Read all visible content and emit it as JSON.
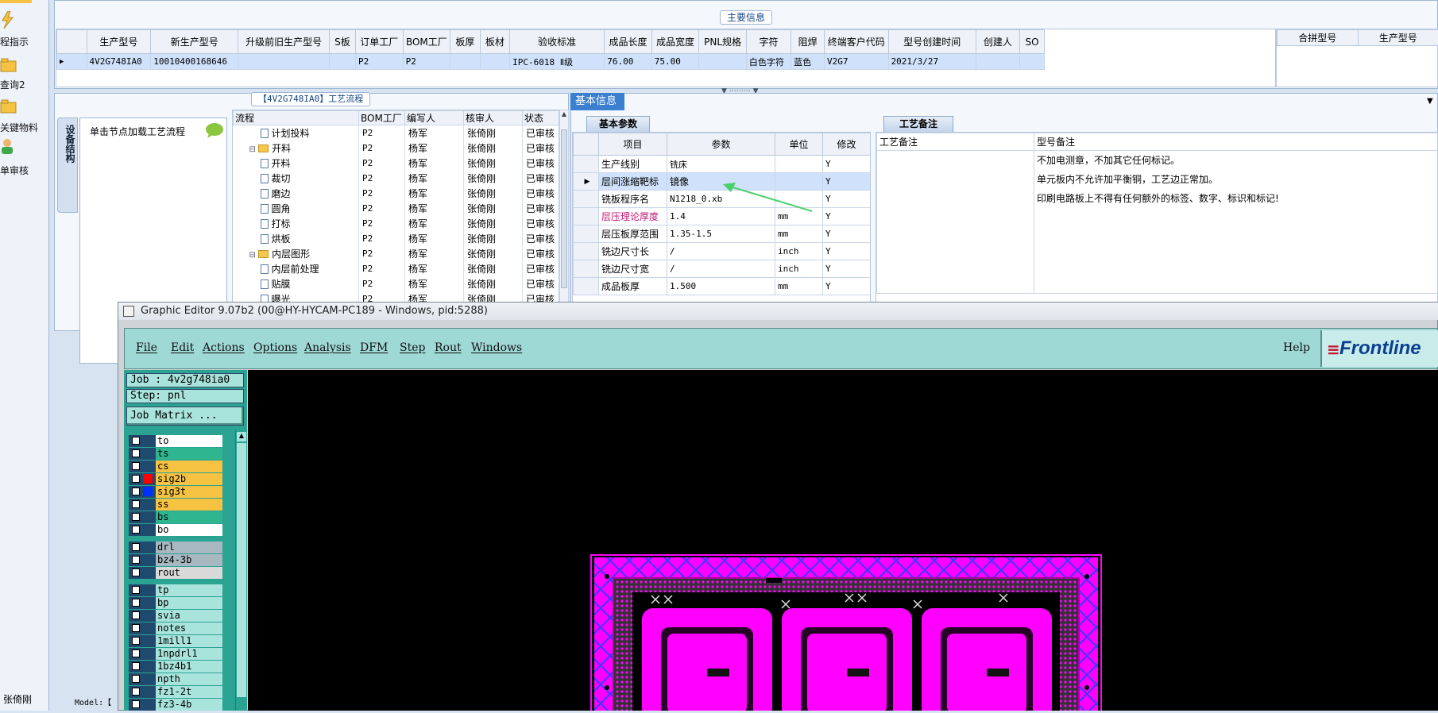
{
  "sidebar": {
    "items": [
      {
        "label": "程指示"
      },
      {
        "label": "查询2"
      },
      {
        "label": "关键物料"
      },
      {
        "label": "单审核"
      }
    ],
    "user": "张倚刚"
  },
  "status": {
    "model": "Model:【"
  },
  "main_info": {
    "title": "主要信息",
    "columns": [
      "生产型号",
      "新生产型号",
      "升级前旧生产型号",
      "S板",
      "订单工厂",
      "BOM工厂",
      "板厚",
      "板材",
      "验收标准",
      "成品长度",
      "成品宽度",
      "PNL规格",
      "字符",
      "阻焊",
      "终端客户代码",
      "型号创建时间",
      "创建人",
      "SO"
    ],
    "row": [
      "4V2G748IA0",
      "10010400168646",
      "",
      "",
      "P2",
      "P2",
      "",
      "",
      "IPC-6018 Ⅱ级",
      "76.00",
      "75.00",
      "",
      "白色字符",
      "蓝色",
      "V2G7",
      "2021/3/27",
      "",
      ""
    ],
    "right_columns": [
      "合拼型号",
      "生产型号"
    ]
  },
  "flow": {
    "title": "【4V2G748IA0】工艺流程",
    "vtab": "设备结构",
    "hint": "单击节点加载工艺流程",
    "columns": [
      "流程",
      "BOM工厂",
      "编写人",
      "核审人",
      "状态"
    ],
    "rows": [
      {
        "name": "计划投料",
        "type": "doc",
        "indent": 1,
        "bom": "P2",
        "writer": "杨军",
        "reviewer": "张倚刚",
        "status": "已审核"
      },
      {
        "name": "开料",
        "type": "folder",
        "indent": 0,
        "bom": "P2",
        "writer": "杨军",
        "reviewer": "张倚刚",
        "status": "已审核"
      },
      {
        "name": "开料",
        "type": "doc",
        "indent": 1,
        "bom": "P2",
        "writer": "杨军",
        "reviewer": "张倚刚",
        "status": "已审核"
      },
      {
        "name": "裁切",
        "type": "doc",
        "indent": 1,
        "bom": "P2",
        "writer": "杨军",
        "reviewer": "张倚刚",
        "status": "已审核"
      },
      {
        "name": "磨边",
        "type": "doc",
        "indent": 1,
        "bom": "P2",
        "writer": "杨军",
        "reviewer": "张倚刚",
        "status": "已审核"
      },
      {
        "name": "圆角",
        "type": "doc",
        "indent": 1,
        "bom": "P2",
        "writer": "杨军",
        "reviewer": "张倚刚",
        "status": "已审核"
      },
      {
        "name": "打标",
        "type": "doc",
        "indent": 1,
        "bom": "P2",
        "writer": "杨军",
        "reviewer": "张倚刚",
        "status": "已审核"
      },
      {
        "name": "烘板",
        "type": "doc",
        "indent": 1,
        "bom": "P2",
        "writer": "杨军",
        "reviewer": "张倚刚",
        "status": "已审核"
      },
      {
        "name": "内层图形",
        "type": "folder",
        "indent": 0,
        "bom": "P2",
        "writer": "杨军",
        "reviewer": "张倚刚",
        "status": "已审核"
      },
      {
        "name": "内层前处理",
        "type": "doc",
        "indent": 1,
        "bom": "P2",
        "writer": "杨军",
        "reviewer": "张倚刚",
        "status": "已审核"
      },
      {
        "name": "贴膜",
        "type": "doc",
        "indent": 1,
        "bom": "P2",
        "writer": "杨军",
        "reviewer": "张倚刚",
        "status": "已审核"
      },
      {
        "name": "曝光",
        "type": "doc",
        "indent": 1,
        "bom": "P2",
        "writer": "杨军",
        "reviewer": "张倚刚",
        "status": "已审核"
      }
    ]
  },
  "basic": {
    "title": "基本信息",
    "tab_params": "基本参数",
    "tab_remarks": "工艺备注",
    "param_columns": [
      "项目",
      "参数",
      "单位",
      "修改"
    ],
    "params": [
      {
        "item": "生产线别",
        "value": "铣床",
        "unit": "",
        "edit": "Y"
      },
      {
        "item": "层间涨缩靶标",
        "value": "镜像",
        "unit": "",
        "edit": "Y",
        "selected": true
      },
      {
        "item": "铣板程序名",
        "value": "N1218_0.xb",
        "unit": "",
        "edit": "Y"
      },
      {
        "item": "层压理论厚度",
        "value": "1.4",
        "unit": "mm",
        "edit": "Y",
        "highlight": true
      },
      {
        "item": "层压板厚范围",
        "value": "1.35-1.5",
        "unit": "mm",
        "edit": "Y"
      },
      {
        "item": "铣边尺寸长",
        "value": "/",
        "unit": "inch",
        "edit": "Y"
      },
      {
        "item": "铣边尺寸宽",
        "value": "/",
        "unit": "inch",
        "edit": "Y"
      },
      {
        "item": "成品板厚",
        "value": "1.500",
        "unit": "mm",
        "edit": "Y"
      }
    ],
    "remark_columns": [
      "工艺备注",
      "型号备注"
    ],
    "remarks": [
      "不加电测章，不加其它任何标记。",
      "单元板内不允许加平衡铜，工艺边正常加。",
      "印刷电路板上不得有任何额外的标签、数字、标识和标记!"
    ]
  },
  "editor": {
    "title": "Graphic Editor 9.07b2 (00@HY-HYCAM-PC189 - Windows, pid:5288)",
    "menu": [
      "File",
      "Edit",
      "Actions",
      "Options",
      "Analysis",
      "DFM",
      "Step",
      "Rout",
      "Windows"
    ],
    "help": "Help",
    "logo": "Frontline",
    "job": "Job : 4v2g748ia0",
    "step": "Step: pnl",
    "job_matrix": "Job Matrix ...",
    "layers": [
      {
        "name": "to",
        "color": "#ffffff",
        "mark": ""
      },
      {
        "name": "ts",
        "color": "#2fb58f",
        "mark": ""
      },
      {
        "name": "cs",
        "color": "#f5c242",
        "mark": ""
      },
      {
        "name": "sig2b",
        "color": "#f5c242",
        "mark": "#ff0000"
      },
      {
        "name": "sig3t",
        "color": "#f5c242",
        "mark": "#0030ff"
      },
      {
        "name": "ss",
        "color": "#f5c242",
        "mark": ""
      },
      {
        "name": "bs",
        "color": "#2fb58f",
        "mark": ""
      },
      {
        "name": "bo",
        "color": "#ffffff",
        "mark": ""
      },
      {
        "name": "drl",
        "color": "#a7b8c0",
        "mark": ""
      },
      {
        "name": "bz4-3b",
        "color": "#a7b8c0",
        "mark": ""
      },
      {
        "name": "rout",
        "color": "#d9d9d9",
        "mark": ""
      },
      {
        "name": "tp",
        "color": "#a8e3dc",
        "mark": ""
      },
      {
        "name": "bp",
        "color": "#a8e3dc",
        "mark": ""
      },
      {
        "name": "svia",
        "color": "#a8e3dc",
        "mark": ""
      },
      {
        "name": "notes",
        "color": "#a8e3dc",
        "mark": ""
      },
      {
        "name": "1mill1",
        "color": "#a8e3dc",
        "mark": ""
      },
      {
        "name": "1npdrl1",
        "color": "#a8e3dc",
        "mark": ""
      },
      {
        "name": "1bz4b1",
        "color": "#a8e3dc",
        "mark": ""
      },
      {
        "name": "npth",
        "color": "#a8e3dc",
        "mark": ""
      },
      {
        "name": "fz1-2t",
        "color": "#a8e3dc",
        "mark": ""
      },
      {
        "name": "fz3-4b",
        "color": "#a8e3dc",
        "mark": ""
      }
    ]
  }
}
